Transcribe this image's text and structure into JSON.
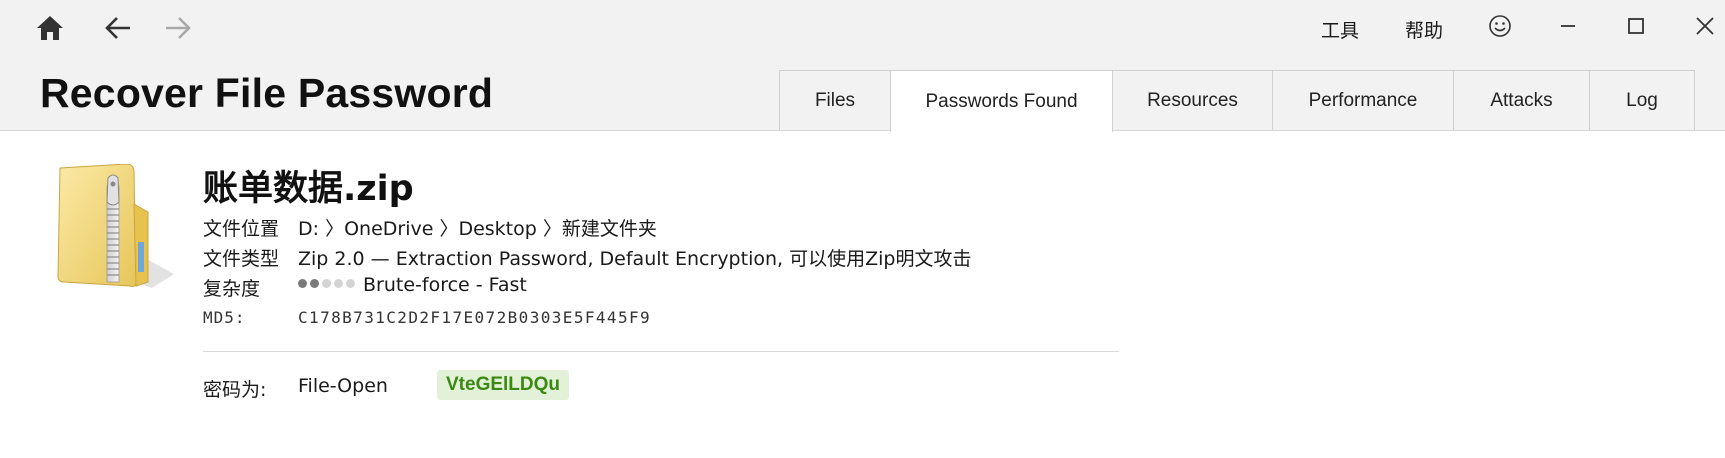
{
  "toolbar": {
    "home_icon": "home-icon",
    "back_icon": "arrow-left-icon",
    "forward_icon": "arrow-right-icon"
  },
  "menu": {
    "tools": "工具",
    "help": "帮助",
    "feedback_icon": "smiley-icon"
  },
  "window": {
    "minimize_icon": "minimize-icon",
    "maximize_icon": "maximize-icon",
    "close_icon": "close-icon"
  },
  "app": {
    "title": "Recover File Password"
  },
  "tabs": [
    {
      "label": "Files",
      "active": false
    },
    {
      "label": "Passwords Found",
      "active": true
    },
    {
      "label": "Resources",
      "active": false
    },
    {
      "label": "Performance",
      "active": false
    },
    {
      "label": "Attacks",
      "active": false
    },
    {
      "label": "Log",
      "active": false
    }
  ],
  "file": {
    "icon": "zip-folder-icon",
    "name": "账单数据.zip",
    "location_label": "文件位置",
    "location_value": "D: 〉OneDrive 〉Desktop 〉新建文件夹",
    "type_label": "文件类型",
    "type_value": "Zip 2.0 — Extraction Password, Default Encryption, 可以使用Zip明文攻击",
    "complexity_label": "复杂度",
    "complexity_value": "Brute-force - Fast",
    "complexity_level": 2,
    "complexity_max": 5,
    "md5_label": "MD5:",
    "md5_value": "C178B731C2D2F17E072B0303E5F445F9"
  },
  "result": {
    "password_label": "密码为:",
    "password_type": "File-Open",
    "password_value": "VteGElLDQu"
  },
  "colors": {
    "titlebar_bg": "#f2f2f2",
    "password_badge_bg": "#e3f1d8",
    "password_badge_text": "#3a8a12"
  }
}
